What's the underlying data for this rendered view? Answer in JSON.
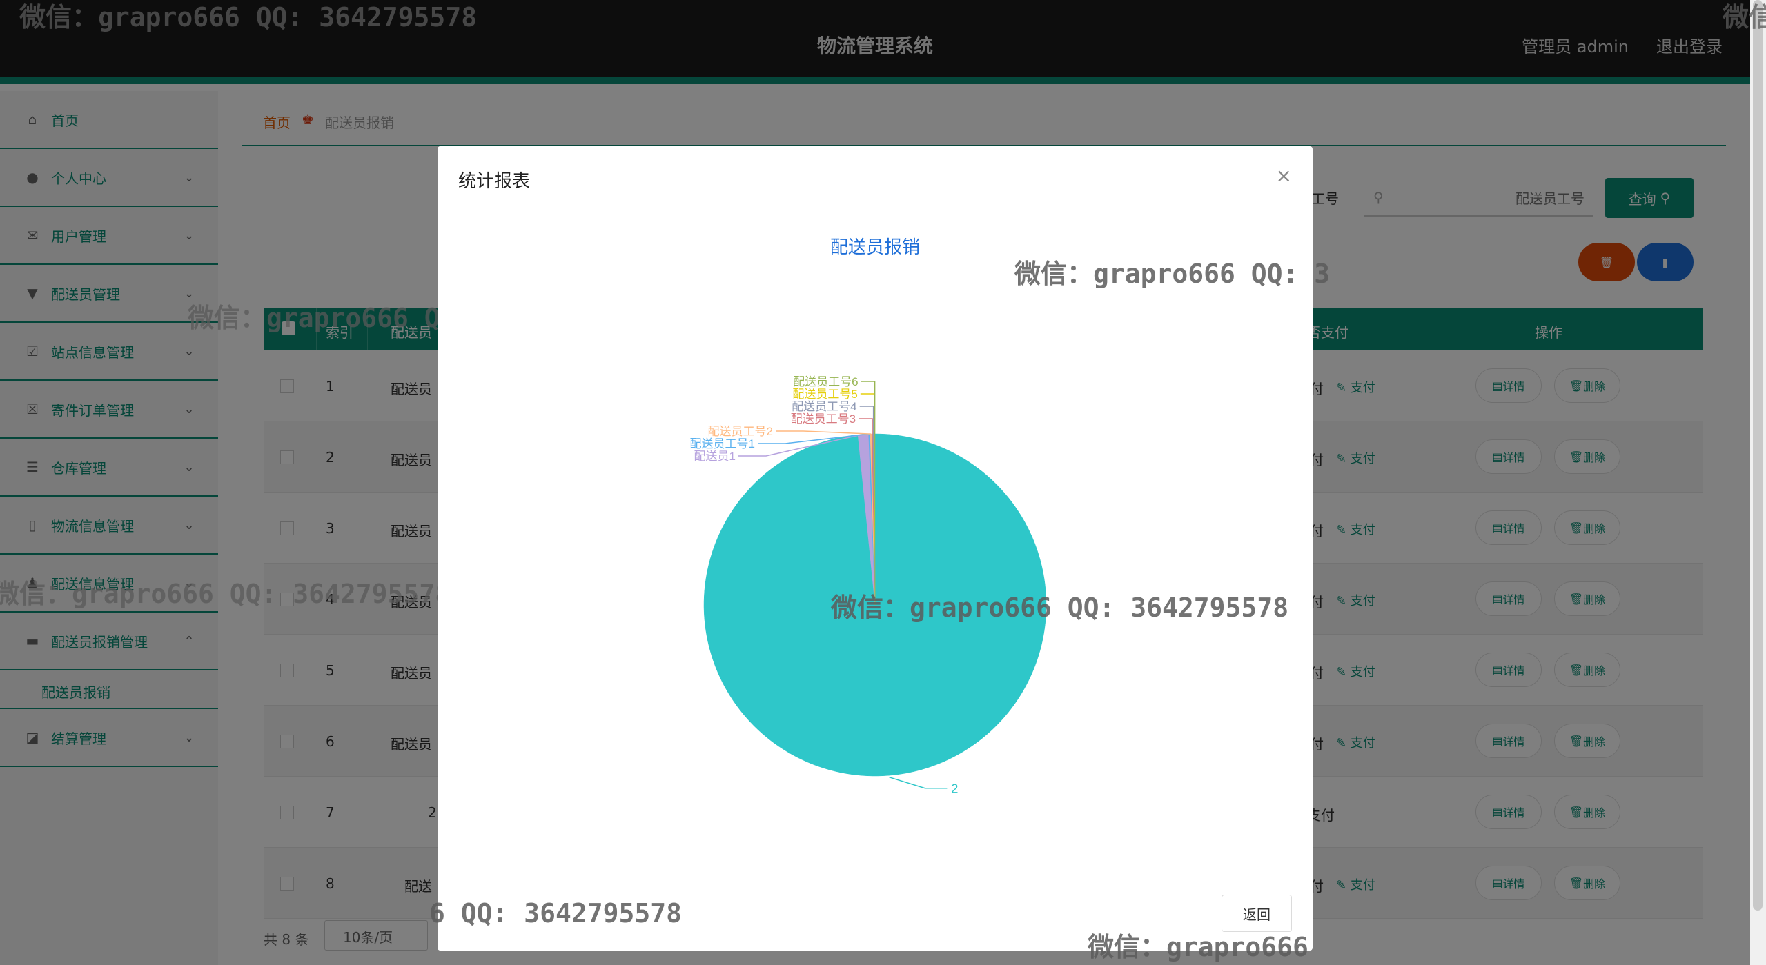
{
  "header": {
    "title": "物流管理系统",
    "admin_label": "管理员 admin",
    "logout_label": "退出登录"
  },
  "sidebar": {
    "items": [
      {
        "label": "首页",
        "icon": "home-icon"
      },
      {
        "label": "个人中心",
        "icon": "user-icon"
      },
      {
        "label": "用户管理",
        "icon": "mail-icon"
      },
      {
        "label": "配送员管理",
        "icon": "pin-icon"
      },
      {
        "label": "站点信息管理",
        "icon": "check-square-icon"
      },
      {
        "label": "寄件订单管理",
        "icon": "x-square-icon"
      },
      {
        "label": "仓库管理",
        "icon": "list-icon"
      },
      {
        "label": "物流信息管理",
        "icon": "phone-icon"
      },
      {
        "label": "配送信息管理",
        "icon": "person-icon"
      },
      {
        "label": "配送员报销管理",
        "icon": "chat-icon"
      },
      {
        "label": "结算管理",
        "icon": "briefcase-icon"
      }
    ],
    "sub_item": "配送员报销"
  },
  "breadcrumb": {
    "home": "首页",
    "current": "配送员报销"
  },
  "search": {
    "label": "员工号",
    "placeholder": "配送员工号",
    "query_label": "查询"
  },
  "table": {
    "headers": [
      "索引",
      "配送员",
      "否支付",
      "操作"
    ],
    "rows": [
      {
        "index": "1",
        "col2": "配送员",
        "pay": "付",
        "pay_link": "支付"
      },
      {
        "index": "2",
        "col2": "配送员",
        "pay": "付",
        "pay_link": "支付"
      },
      {
        "index": "3",
        "col2": "配送员",
        "pay": "付",
        "pay_link": "支付"
      },
      {
        "index": "4",
        "col2": "配送员",
        "pay": "付",
        "pay_link": "支付"
      },
      {
        "index": "5",
        "col2": "配送员",
        "pay": "付",
        "pay_link": "支付"
      },
      {
        "index": "6",
        "col2": "配送员",
        "pay": "付",
        "pay_link": "支付"
      },
      {
        "index": "7",
        "col2": "2",
        "pay": "支付",
        "pay_link": ""
      },
      {
        "index": "8",
        "col2": "配送",
        "pay": "付",
        "pay_link": "支付"
      }
    ],
    "detail_label": "详情",
    "delete_label": "删除"
  },
  "pager": {
    "total": "共 8 条",
    "size": "10条/页"
  },
  "modal": {
    "title": "统计报表",
    "back_label": "返回"
  },
  "chart_data": {
    "type": "pie",
    "title": "配送员报销",
    "slices": [
      {
        "name": "2",
        "value": 98.4,
        "color": "#2ec7c9"
      },
      {
        "name": "配送员1",
        "value": 1.0,
        "color": "#b6a2de"
      },
      {
        "name": "配送员工号1",
        "value": 0.15,
        "color": "#5ab1ef"
      },
      {
        "name": "配送员工号2",
        "value": 0.15,
        "color": "#ffb980"
      },
      {
        "name": "配送员工号3",
        "value": 0.1,
        "color": "#d87a80"
      },
      {
        "name": "配送员工号4",
        "value": 0.1,
        "color": "#8d98b3"
      },
      {
        "name": "配送员工号5",
        "value": 0.05,
        "color": "#e5cf0d"
      },
      {
        "name": "配送员工号6",
        "value": 0.05,
        "color": "#97b552"
      }
    ]
  },
  "watermark": {
    "text": "微信：grapro666 QQ: 3642795578",
    "partial_right": "微信：grapro666 QQ: 3",
    "partial_left": "6 QQ: 3642795578",
    "partial_short": "微信：grapro666",
    "corner": "微信"
  }
}
